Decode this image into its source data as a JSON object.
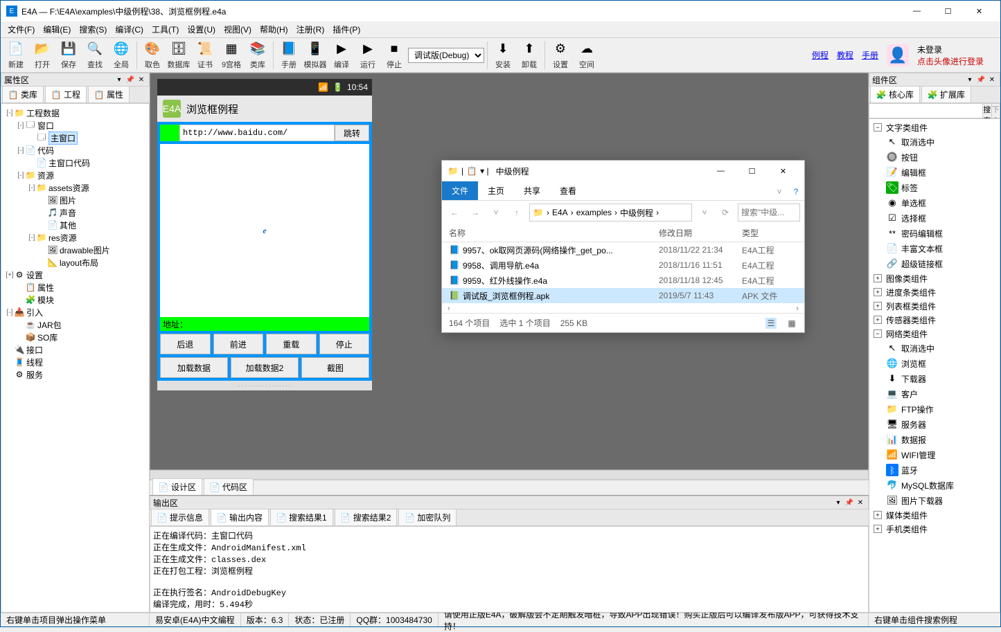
{
  "window": {
    "title": "E4A — F:\\E4A\\examples\\中级例程\\38、浏览框例程.e4a"
  },
  "menu": [
    "文件(F)",
    "编辑(E)",
    "搜索(S)",
    "编译(C)",
    "工具(T)",
    "设置(U)",
    "视图(V)",
    "帮助(H)",
    "注册(R)",
    "插件(P)"
  ],
  "toolbar": [
    {
      "label": "新建",
      "icon": "📄"
    },
    {
      "label": "打开",
      "icon": "📂"
    },
    {
      "label": "保存",
      "icon": "💾"
    },
    {
      "label": "查找",
      "icon": "🔍"
    },
    {
      "label": "全局",
      "icon": "🌐"
    },
    {
      "sep": true
    },
    {
      "label": "取色",
      "icon": "🎨"
    },
    {
      "label": "数据库",
      "icon": "🗄"
    },
    {
      "label": "证书",
      "icon": "📜"
    },
    {
      "label": "9宫格",
      "icon": "▦"
    },
    {
      "label": "类库",
      "icon": "📚"
    },
    {
      "sep": true
    },
    {
      "label": "手册",
      "icon": "📘"
    },
    {
      "label": "模拟器",
      "icon": "📱"
    },
    {
      "label": "编译",
      "icon": "▶"
    },
    {
      "label": "运行",
      "icon": "▶"
    },
    {
      "label": "停止",
      "icon": "■"
    },
    {
      "combo": "调试版(Debug)"
    },
    {
      "sep": true
    },
    {
      "label": "安装",
      "icon": "⬇"
    },
    {
      "label": "卸载",
      "icon": "⬆"
    },
    {
      "sep": true
    },
    {
      "label": "设置",
      "icon": "⚙"
    },
    {
      "label": "空间",
      "icon": "☁"
    }
  ],
  "toolbar_links": [
    "例程",
    "教程",
    "手册"
  ],
  "login": {
    "status": "未登录",
    "hint": "点击头像进行登录"
  },
  "prop_panel": {
    "title": "属性区",
    "tabs": [
      "类库",
      "工程",
      "属性"
    ],
    "active": 1
  },
  "project_tree": [
    {
      "d": 0,
      "tw": "-",
      "ic": "📁",
      "tx": "工程数据"
    },
    {
      "d": 1,
      "tw": "-",
      "ic": "🗔",
      "tx": "窗口"
    },
    {
      "d": 2,
      "tw": "",
      "ic": "🗔",
      "tx": "主窗口",
      "sel": true
    },
    {
      "d": 1,
      "tw": "-",
      "ic": "📄",
      "tx": "代码"
    },
    {
      "d": 2,
      "tw": "",
      "ic": "📄",
      "tx": "主窗口代码"
    },
    {
      "d": 1,
      "tw": "-",
      "ic": "📁",
      "tx": "资源"
    },
    {
      "d": 2,
      "tw": "-",
      "ic": "📁",
      "tx": "assets资源"
    },
    {
      "d": 3,
      "tw": "",
      "ic": "🖼",
      "tx": "图片"
    },
    {
      "d": 3,
      "tw": "",
      "ic": "🎵",
      "tx": "声音"
    },
    {
      "d": 3,
      "tw": "",
      "ic": "📄",
      "tx": "其他"
    },
    {
      "d": 2,
      "tw": "-",
      "ic": "📁",
      "tx": "res资源"
    },
    {
      "d": 3,
      "tw": "",
      "ic": "🖼",
      "tx": "drawable图片"
    },
    {
      "d": 3,
      "tw": "",
      "ic": "📐",
      "tx": "layout布局"
    },
    {
      "d": 0,
      "tw": "+",
      "ic": "⚙",
      "tx": "设置"
    },
    {
      "d": 1,
      "tw": "",
      "ic": "📋",
      "tx": "属性"
    },
    {
      "d": 1,
      "tw": "",
      "ic": "🧩",
      "tx": "模块"
    },
    {
      "d": 0,
      "tw": "-",
      "ic": "📥",
      "tx": "引入"
    },
    {
      "d": 1,
      "tw": "",
      "ic": "☕",
      "tx": "JAR包"
    },
    {
      "d": 1,
      "tw": "",
      "ic": "📦",
      "tx": "SO库"
    },
    {
      "d": 0,
      "tw": "",
      "ic": "🔌",
      "tx": "接口"
    },
    {
      "d": 0,
      "tw": "",
      "ic": "🧵",
      "tx": "线程"
    },
    {
      "d": 0,
      "tw": "",
      "ic": "⚙",
      "tx": "服务"
    }
  ],
  "phone": {
    "time": "10:54",
    "title": "浏览框例程",
    "url": "http://www.baidu.com/",
    "go": "跳转",
    "addr": "地址：",
    "row1": [
      "后退",
      "前进",
      "重载",
      "停止"
    ],
    "row2": [
      "加载数据",
      "加载数据2",
      "截图"
    ]
  },
  "design_tabs": [
    "设计区",
    "代码区"
  ],
  "output": {
    "title": "输出区",
    "tabs": [
      "提示信息",
      "输出内容",
      "搜索结果1",
      "搜索结果2",
      "加密队列"
    ],
    "active": 1,
    "text": "正在编译代码：主窗口代码\n正在生成文件：AndroidManifest.xml\n正在生成文件：classes.dex\n正在打包工程：浏览框例程\n\n正在执行签名：AndroidDebugKey\n编译完成，用时：5.494秒"
  },
  "footer": {
    "left": "右键单击项目弹出操作菜单",
    "cells": [
      "易安卓(E4A)中文编程",
      "版本：6.3",
      "状态：已注册",
      "QQ群：1003484730"
    ],
    "msg": "请使用正版E4A，破解版会不定期触发暗桩，导致APP出现错误！购买正版后可以编译发布版APP，可获得技术支持！",
    "right": "右键单击组件搜索例程"
  },
  "comp_panel": {
    "title": "组件区",
    "tabs": [
      "核心库",
      "扩展库"
    ],
    "search_btn": "搜索",
    "next_btn": "下个"
  },
  "components": [
    {
      "cat": "文字类组件",
      "open": true,
      "items": [
        {
          "ic": "↖",
          "tx": "取消选中"
        },
        {
          "ic": "🔘",
          "tx": "按钮"
        },
        {
          "ic": "📝",
          "tx": "编辑框"
        },
        {
          "ic": "🏷",
          "tx": "标签",
          "hl": "#0a0"
        },
        {
          "ic": "◉",
          "tx": "单选框"
        },
        {
          "ic": "☑",
          "tx": "选择框"
        },
        {
          "ic": "**",
          "tx": "密码编辑框"
        },
        {
          "ic": "📄",
          "tx": "丰富文本框"
        },
        {
          "ic": "🔗",
          "tx": "超级链接框"
        }
      ]
    },
    {
      "cat": "图像类组件",
      "open": false
    },
    {
      "cat": "进度条类组件",
      "open": false
    },
    {
      "cat": "列表框类组件",
      "open": false
    },
    {
      "cat": "传感器类组件",
      "open": false
    },
    {
      "cat": "网络类组件",
      "open": true,
      "items": [
        {
          "ic": "↖",
          "tx": "取消选中"
        },
        {
          "ic": "🌐",
          "tx": "浏览框"
        },
        {
          "ic": "⬇",
          "tx": "下载器"
        },
        {
          "ic": "💻",
          "tx": "客户"
        },
        {
          "ic": "📁",
          "tx": "FTP操作"
        },
        {
          "ic": "🖥",
          "tx": "服务器"
        },
        {
          "ic": "📊",
          "tx": "数据报"
        },
        {
          "ic": "📶",
          "tx": "WIFI管理"
        },
        {
          "ic": "ᛒ",
          "tx": "蓝牙",
          "hl": "#07f"
        },
        {
          "ic": "🐬",
          "tx": "MySQL数据库"
        },
        {
          "ic": "🖼",
          "tx": "图片下载器"
        }
      ]
    },
    {
      "cat": "媒体类组件",
      "open": false
    },
    {
      "cat": "手机类组件",
      "open": false
    }
  ],
  "explorer": {
    "title": "中级例程",
    "ribbon": [
      "文件",
      "主页",
      "共享",
      "查看"
    ],
    "crumbs": [
      "E4A",
      "examples",
      "中级例程"
    ],
    "search_ph": "搜索\"中级...",
    "columns": [
      "名称",
      "修改日期",
      "类型"
    ],
    "rows": [
      {
        "ic": "📘",
        "n": "9957、ok取网页源码(网络操作_get_po...",
        "d": "2018/11/22 21:34",
        "t": "E4A工程"
      },
      {
        "ic": "📘",
        "n": "9958、调用导航.e4a",
        "d": "2018/11/16 11:51",
        "t": "E4A工程"
      },
      {
        "ic": "📘",
        "n": "9959、红外线操作.e4a",
        "d": "2018/11/18 12:45",
        "t": "E4A工程"
      },
      {
        "ic": "📗",
        "n": "调试版_浏览框例程.apk",
        "d": "2019/5/7 11:43",
        "t": "APK 文件",
        "sel": true
      }
    ],
    "status": [
      "164 个项目",
      "选中 1 个项目",
      "255 KB"
    ]
  }
}
